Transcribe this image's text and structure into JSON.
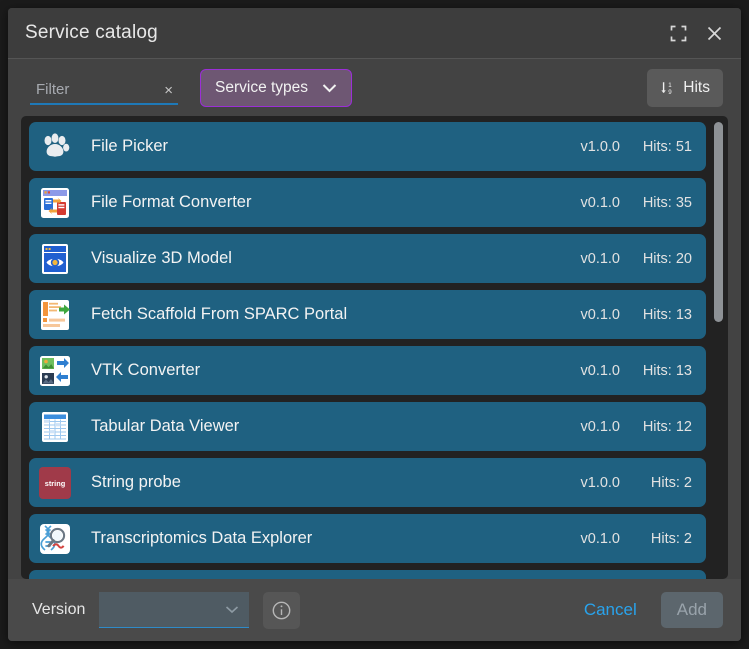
{
  "window": {
    "title": "Service catalog",
    "expand_icon": "expand-icon",
    "close_icon": "close-icon"
  },
  "toolbar": {
    "filter_value": "",
    "filter_placeholder": "Filter",
    "filter_clear_label": "×",
    "service_types_label": "Service types",
    "service_types_chevron": "chevron-down-icon",
    "hits_label": "Hits",
    "hits_sort_icon": "sort-ascending-icon"
  },
  "list": {
    "rows": [
      {
        "name": "File Picker",
        "version": "v1.0.0",
        "hits": "Hits: 51",
        "icon": "paw-print-icon"
      },
      {
        "name": "File Format Converter",
        "version": "v0.1.0",
        "hits": "Hits: 35",
        "icon": "file-format-converter-icon"
      },
      {
        "name": "Visualize 3D Model",
        "version": "v0.1.0",
        "hits": "Hits: 20",
        "icon": "eye-viewer-icon"
      },
      {
        "name": "Fetch Scaffold From SPARC Portal",
        "version": "v0.1.0",
        "hits": "Hits: 13",
        "icon": "fetch-scaffold-icon"
      },
      {
        "name": "VTK Converter",
        "version": "v0.1.0",
        "hits": "Hits: 13",
        "icon": "vtk-converter-icon"
      },
      {
        "name": "Tabular Data Viewer",
        "version": "v0.1.0",
        "hits": "Hits: 12",
        "icon": "table-grid-icon"
      },
      {
        "name": "String probe",
        "version": "v1.0.0",
        "hits": "Hits: 2",
        "icon": "string-probe-icon"
      },
      {
        "name": "Transcriptomics Data Explorer",
        "version": "v0.1.0",
        "hits": "Hits: 2",
        "icon": "transcriptomics-icon"
      }
    ]
  },
  "footer": {
    "version_label": "Version",
    "version_value": "",
    "version_chevron": "chevron-down-icon",
    "info_icon": "info-icon",
    "cancel_label": "Cancel",
    "add_label": "Add"
  },
  "colors": {
    "dialog_bg": "#434343",
    "titlebar_bg": "#3d3d3d",
    "list_bg": "#222222",
    "row_bg": "#1f6181",
    "footer_bg": "#4a4a4a",
    "accent_purple": "#9b2fd6",
    "accent_blue": "#29a3ec",
    "underline_blue": "#1e79b8"
  }
}
